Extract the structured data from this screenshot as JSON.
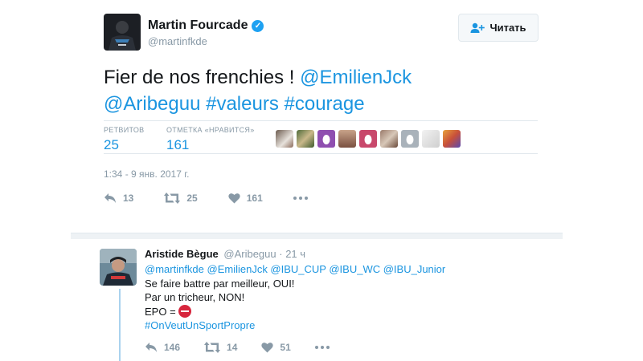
{
  "tweet": {
    "author_name": "Martin Fourcade",
    "author_handle": "@martinfkde",
    "follow_label": "Читать",
    "text_parts": [
      "Fier de nos frenchies ! ",
      "@EmilienJck",
      "@Aribeguu",
      "#valeurs",
      "#courage"
    ],
    "stats": {
      "retweets_label": "РЕТВИТОВ",
      "retweets_value": "25",
      "likes_label": "ОТМЕТКА «НРАВИТСЯ»",
      "likes_value": "161"
    },
    "timestamp": "1:34 - 9 янв. 2017 г.",
    "actions": {
      "reply_count": "13",
      "retweet_count": "25",
      "like_count": "161"
    }
  },
  "reply": {
    "author_name": "Aristide Bègue",
    "author_handle": "@Aribeguu",
    "time": "· 21 ч",
    "mentions": "@martinfkde @EmilienJck @IBU_CUP @IBU_WC @IBU_Junior",
    "line1": "Se faire battre par meilleur, OUI!",
    "line2": "Par un tricheur, NON!",
    "line3": "EPO = ",
    "hashtag": "#OnVeutUnSportPropre",
    "actions": {
      "reply_count": "146",
      "retweet_count": "14",
      "like_count": "51"
    }
  },
  "colors": {
    "link": "#1b95e0",
    "muted": "#8899a6",
    "verified": "#1da1f2"
  }
}
